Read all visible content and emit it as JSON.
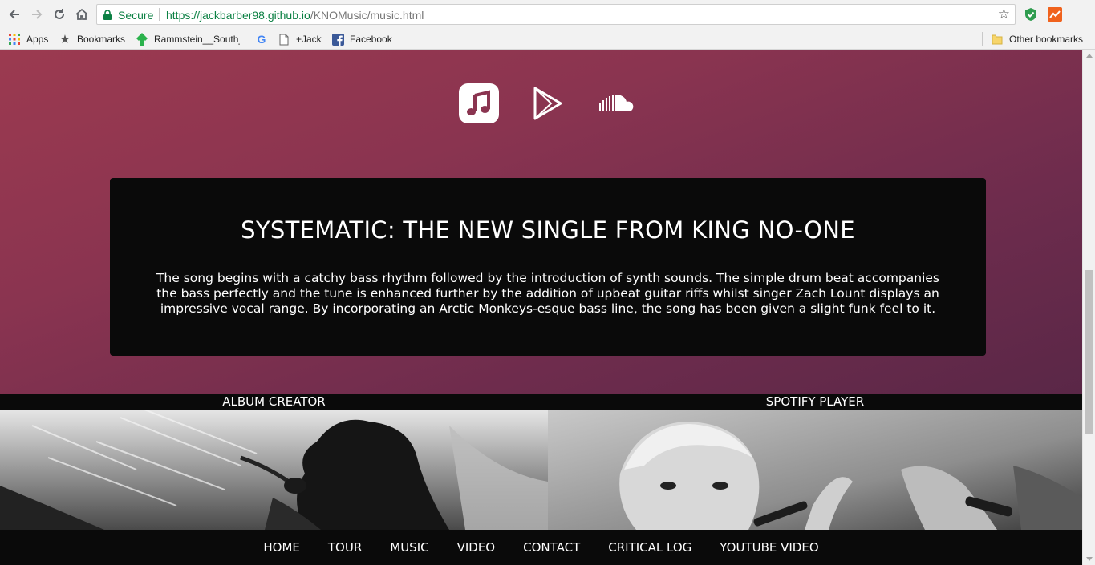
{
  "browser": {
    "secure_label": "Secure",
    "url_host": "https://jackbarber98.github.io",
    "url_path": "/KNOMusic/music.html",
    "bookmarks": {
      "apps": "Apps",
      "bookmarks": "Bookmarks",
      "rammstein": "Rammstein__South_l",
      "jack": "+Jack",
      "facebook": "Facebook",
      "other": "Other bookmarks"
    }
  },
  "social": {
    "icons": [
      "apple-music-icon",
      "google-play-icon",
      "soundcloud-icon"
    ]
  },
  "feature": {
    "title": "SYSTEMATIC: THE NEW SINGLE FROM KING NO-ONE",
    "body": "The song begins with a catchy bass rhythm followed by the introduction of synth sounds. The simple drum beat accompanies the bass perfectly and the tune is enhanced further by the addition of upbeat guitar riffs whilst singer Zach Lount displays an impressive vocal range. By incorporating an Arctic Monkeys-esque bass line, the song has been given a slight funk feel to it."
  },
  "columns": {
    "left_label": "ALBUM CREATOR",
    "right_label": "SPOTIFY PLAYER"
  },
  "nav": {
    "items": [
      "HOME",
      "TOUR",
      "MUSIC",
      "VIDEO",
      "CONTACT",
      "CRITICAL LOG",
      "YOUTUBE VIDEO"
    ]
  },
  "colors": {
    "hero_start": "#9c3a50",
    "hero_end": "#5a2747",
    "card_bg": "#0a0a0a",
    "secure_green": "#0b8043"
  }
}
